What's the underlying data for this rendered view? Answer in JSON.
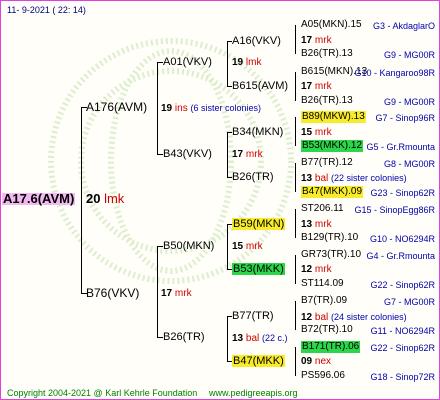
{
  "header": {
    "date_text": "11-  9-2021 ( 22: 14)"
  },
  "footer": {
    "copyright": "Copyright 2004-2021 @ Karl Kehrle Foundation",
    "url": "www.pedigreeapis.org"
  },
  "root": {
    "name": "A17.6(AVM)",
    "gen": "20",
    "label": "lmk"
  },
  "g1": [
    {
      "name": "A176(AVM)",
      "gen": "19",
      "label": "ins",
      "note": "(6 sister colonies)"
    },
    {
      "name": "B76(VKV)",
      "gen": "17",
      "label": "mrk"
    }
  ],
  "g2": [
    {
      "name": "A01(VKV)",
      "gen": "19",
      "label": "lmk"
    },
    {
      "name": "B43(VKV)",
      "gen": "17",
      "label": "mrk"
    },
    {
      "name": "B50(MKN)",
      "gen": "15",
      "label": "mrk"
    },
    {
      "name": "B26(TR)",
      "gen": "13",
      "label": "bal",
      "note": "(22 c.)"
    }
  ],
  "g3": [
    {
      "name": "A16(VKV)",
      "gen": "17",
      "label": "mrk"
    },
    {
      "name": "B615(AVM)",
      "gen": "17",
      "label": "mrk"
    },
    {
      "name": "B34(MKN)",
      "gen": "15",
      "label": "mrk"
    },
    {
      "name": "B26(TR)",
      "gen": "13",
      "label": "bal",
      "note": "(22 sister colonies)"
    },
    {
      "name": "B59(MKN)",
      "gen": "13",
      "label": "mrk"
    },
    {
      "name": "B53(MKK)",
      "gen": "12",
      "label": "mrk"
    },
    {
      "name": "B77(TR)",
      "gen": "12",
      "label": "bal",
      "note": "(24 sister colonies)"
    },
    {
      "name": "B47(MKK)",
      "gen": "09",
      "label": "nex"
    }
  ],
  "g4": [
    {
      "name": "A05(MKN).15",
      "info": "G3 - AkdaglarO"
    },
    {
      "name": "B26(TR).13",
      "info": "G9 - MG00R"
    },
    {
      "name": "B615(MKN).13",
      "info": "G10 - Kangaroo98R"
    },
    {
      "name": "B26(TR).13",
      "info": "G9 - MG00R"
    },
    {
      "name": "B89(MKW).13",
      "info": "G7 - Sinop96R"
    },
    {
      "name": "B53(MKK).12",
      "info": "G5 - Gr.Rmounta"
    },
    {
      "name": "B77(TR).12",
      "info": "G8 - MG00R"
    },
    {
      "name": "B47(MKK).09",
      "info": "G23 - Sinop62R"
    },
    {
      "name": "ST206.11",
      "info": "G15 - SinopEgg86R"
    },
    {
      "name": "B129(TR).10",
      "info": "G10 - NO6294R"
    },
    {
      "name": "GR73(TR).10",
      "info": "G4 - Gr.Rmounta"
    },
    {
      "name": "ST114.09",
      "info": "G22 - Sinop62R"
    },
    {
      "name": "B7(TR).09",
      "info": "G7 - MG00R"
    },
    {
      "name": "B72(TR).10",
      "info": "G11 - NO6294R"
    },
    {
      "name": "B171(TR).06",
      "info": "G22 - Sinop62R"
    },
    {
      "name": "PS596.06",
      "info": "G18 - Sinop72R"
    }
  ]
}
